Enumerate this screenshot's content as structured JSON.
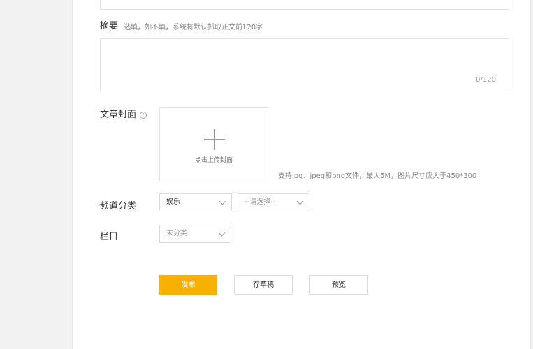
{
  "summary": {
    "label": "摘要",
    "hint": "选填，如不填，系统将默认抓取正文前120字",
    "counter": "0/120"
  },
  "cover": {
    "label": "文章封面",
    "help_icon": "?",
    "upload_text": "点击上传封面",
    "note": "支持jpg、jpeg和png文件，最大5M，图片尺寸应大于450*300"
  },
  "channel": {
    "label": "频道分类",
    "primary_value": "娱乐",
    "secondary_placeholder": "--请选择--"
  },
  "column": {
    "label": "栏目",
    "placeholder": "未分类"
  },
  "actions": {
    "publish": "发布",
    "save_draft": "存草稿",
    "preview": "预览"
  },
  "colors": {
    "accent": "#f8b100"
  }
}
